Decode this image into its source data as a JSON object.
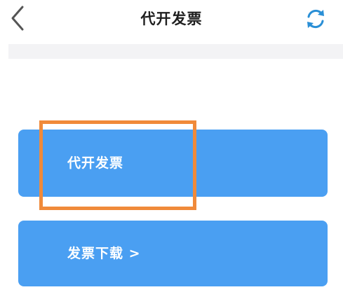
{
  "header": {
    "title": "代开发票",
    "back_icon": "chevron-left-icon",
    "refresh_icon": "refresh-icon"
  },
  "actions": [
    {
      "label": "代开发票"
    },
    {
      "label": "发票下载 >"
    }
  ],
  "colors": {
    "button_blue": "#4a9ff2",
    "highlight_orange": "#f08a3a",
    "refresh_icon": "#2a8fd6",
    "title_text": "#1f1f1f"
  }
}
